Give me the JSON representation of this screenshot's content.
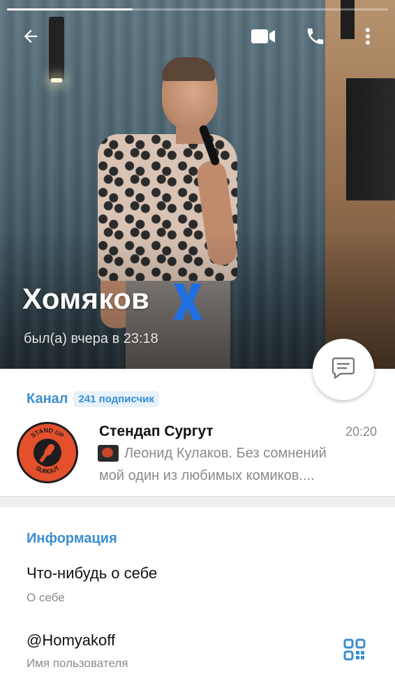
{
  "header": {
    "name": "Хомяков",
    "status": "был(а) вчера в 23:18",
    "photo_progress": 0.33
  },
  "icons": {
    "back": "arrow-left-icon",
    "video": "video-camera-icon",
    "call": "phone-icon",
    "menu": "more-vertical-icon",
    "message": "message-icon",
    "qr": "qr-code-icon"
  },
  "channel": {
    "section_label": "Канал",
    "subscribers": "241 подписчик",
    "title": "Стендап Сургут",
    "time": "20:20",
    "preview_line1": "Леонид Кулаков. Без сомнений",
    "preview_line2": "мой один из любимых комиков....",
    "logo_text_top": "STAND UP",
    "logo_text_bottom": "SURGUT"
  },
  "info": {
    "title": "Информация",
    "about_value": "Что-нибудь о себе",
    "about_label": "О себе",
    "username_value": "@Homyakoff",
    "username_label": "Имя пользователя"
  },
  "colors": {
    "accent": "#3a8ed1",
    "badge_bg": "#e6f1fa",
    "name_mark": "#1f6fe0"
  }
}
